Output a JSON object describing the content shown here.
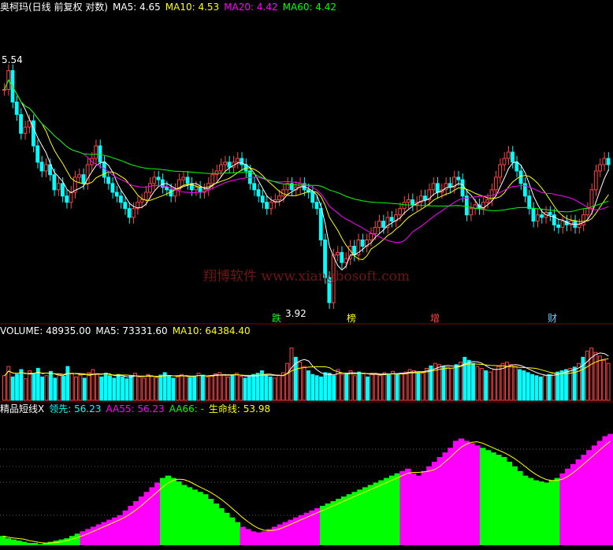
{
  "chart_data": [
    {
      "type": "candlestick",
      "panel": "price",
      "header": [
        {
          "text": "奥柯玛(日线 前复权 对数)",
          "color": "#ffffff"
        },
        {
          "text": "MA5: 4.65",
          "color": "#ffffff"
        },
        {
          "text": "MA10: 4.53",
          "color": "#ffff00"
        },
        {
          "text": "MA20: 4.42",
          "color": "#ff00ff"
        },
        {
          "text": "MA60: 4.42",
          "color": "#00ff00"
        }
      ],
      "ylim": [
        3.5,
        5.9
      ],
      "start_close": 5.3,
      "closes": [
        5.3,
        5.45,
        5.2,
        5.1,
        4.95,
        5.0,
        5.05,
        4.85,
        4.72,
        4.65,
        4.7,
        4.62,
        4.5,
        4.55,
        4.45,
        4.4,
        4.48,
        4.6,
        4.62,
        4.55,
        4.7,
        4.75,
        4.85,
        4.72,
        4.6,
        4.55,
        4.48,
        4.45,
        4.4,
        4.35,
        4.28,
        4.35,
        4.4,
        4.42,
        4.48,
        4.55,
        4.6,
        4.58,
        4.52,
        4.5,
        4.45,
        4.5,
        4.58,
        4.6,
        4.55,
        4.5,
        4.52,
        4.48,
        4.5,
        4.55,
        4.62,
        4.65,
        4.7,
        4.72,
        4.68,
        4.72,
        4.75,
        4.7,
        4.65,
        4.55,
        4.5,
        4.45,
        4.4,
        4.35,
        4.4,
        4.42,
        4.45,
        4.5,
        4.55,
        4.5,
        4.52,
        4.55,
        4.5,
        4.48,
        4.4,
        4.35,
        4.1,
        3.8,
        3.6,
        3.98,
        4.0,
        3.92,
        3.95,
        4.05,
        3.98,
        4.1,
        4.05,
        4.1,
        4.15,
        4.2,
        4.25,
        4.2,
        4.28,
        4.25,
        4.3,
        4.35,
        4.4,
        4.42,
        4.38,
        4.4,
        4.45,
        4.42,
        4.5,
        4.55,
        4.48,
        4.5,
        4.55,
        4.52,
        4.6,
        4.58,
        4.45,
        4.3,
        4.35,
        4.38,
        4.35,
        4.4,
        4.42,
        4.5,
        4.6,
        4.7,
        4.75,
        4.8,
        4.72,
        4.65,
        4.55,
        4.45,
        4.35,
        4.25,
        4.3,
        4.28,
        4.32,
        4.3,
        4.22,
        4.2,
        4.25,
        4.22,
        4.25,
        4.2,
        4.22,
        4.3,
        4.35,
        4.5,
        4.65,
        4.7,
        4.75,
        4.7
      ],
      "annotations": [
        {
          "text": "5.54",
          "color": "#ffffff"
        },
        {
          "text": "3.92",
          "color": "#ffffff"
        },
        {
          "text": "跌",
          "color": "#00ff00"
        },
        {
          "text": "榜",
          "color": "#ffff00"
        },
        {
          "text": "增",
          "color": "#ff4444"
        },
        {
          "text": "财",
          "color": "#66ccff"
        }
      ],
      "watermark": "翔博软件 www.xiangbosoft.com"
    },
    {
      "type": "bar",
      "panel": "volume",
      "header": [
        {
          "text": "VOLUME: 48935.00",
          "color": "#ffffff"
        },
        {
          "text": "MA5: 73331.60",
          "color": "#ffffff"
        },
        {
          "text": "MA10: 64384.40",
          "color": "#ffff00"
        }
      ],
      "values": [
        40,
        55,
        38,
        42,
        50,
        35,
        48,
        44,
        52,
        38,
        40,
        47,
        36,
        42,
        39,
        55,
        44,
        38,
        41,
        36,
        45,
        50,
        42,
        38,
        44,
        40,
        36,
        42,
        38,
        35,
        40,
        44,
        38,
        36,
        42,
        39,
        37,
        41,
        45,
        40,
        36,
        38,
        42,
        40,
        37,
        39,
        44,
        41,
        38,
        40,
        43,
        45,
        42,
        38,
        40,
        44,
        39,
        36,
        38,
        42,
        44,
        48,
        40,
        38,
        36,
        41,
        45,
        60,
        85,
        70,
        62,
        55,
        48,
        42,
        40,
        38,
        45,
        44,
        40,
        50,
        42,
        44,
        48,
        40,
        46,
        43,
        38,
        44,
        42,
        40,
        45,
        43,
        47,
        42,
        44,
        46,
        50,
        48,
        45,
        44,
        52,
        56,
        60,
        58,
        55,
        54,
        52,
        58,
        62,
        70,
        65,
        60,
        55,
        52,
        48,
        46,
        50,
        55,
        60,
        62,
        58,
        55,
        50,
        48,
        45,
        42,
        40,
        38,
        40,
        42,
        44,
        46,
        48,
        50,
        52,
        54,
        60,
        70,
        80,
        85,
        78,
        72,
        65,
        60
      ],
      "ylim": [
        0,
        100
      ]
    },
    {
      "type": "bar",
      "panel": "indicator",
      "header": [
        {
          "text": "精品短线X",
          "color": "#ffffff"
        },
        {
          "text": "领先: 56.23",
          "color": "#00ffff"
        },
        {
          "text": "AA55: 56.23",
          "color": "#ff00ff"
        },
        {
          "text": "AA66: -",
          "color": "#00ff00"
        },
        {
          "text": "生命线: 53.98",
          "color": "#ffff00"
        }
      ],
      "values": [
        8,
        6,
        5,
        4,
        3,
        2,
        2,
        1,
        2,
        3,
        4,
        5,
        6,
        8,
        10,
        12,
        14,
        16,
        18,
        20,
        22,
        24,
        26,
        30,
        34,
        38,
        42,
        46,
        50,
        54,
        58,
        60,
        58,
        55,
        52,
        50,
        48,
        46,
        44,
        40,
        36,
        32,
        28,
        24,
        20,
        16,
        14,
        12,
        11,
        12,
        14,
        16,
        18,
        20,
        22,
        24,
        26,
        28,
        30,
        32,
        34,
        36,
        38,
        40,
        42,
        44,
        46,
        48,
        50,
        52,
        54,
        56,
        58,
        60,
        62,
        64,
        66,
        62,
        60,
        64,
        68,
        72,
        76,
        80,
        84,
        90,
        92,
        90,
        88,
        86,
        84,
        82,
        80,
        78,
        76,
        72,
        68,
        64,
        60,
        58,
        56,
        55,
        54,
        56,
        58,
        62,
        66,
        70,
        74,
        78,
        82,
        86,
        90,
        94,
        96
      ],
      "segments": [
        "green",
        "magenta",
        "green",
        "magenta",
        "green",
        "magenta",
        "green",
        "magenta"
      ],
      "ylim": [
        0,
        110
      ]
    }
  ]
}
